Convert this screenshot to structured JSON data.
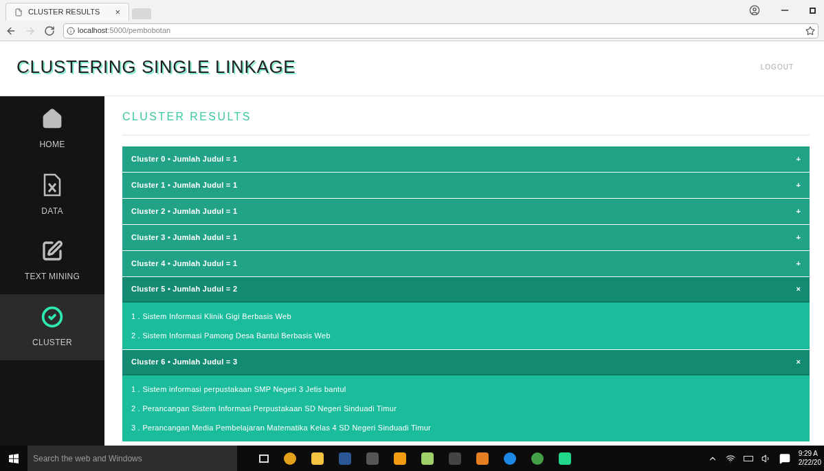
{
  "browser": {
    "tab_title": "CLUSTER RESULTS",
    "tab_close": "×",
    "url_host": "localhost",
    "url_path": ":5000/pembobotan"
  },
  "header": {
    "title": "CLUSTERING SINGLE LINKAGE",
    "logout": "LOGOUT"
  },
  "sidebar": {
    "items": [
      {
        "label": "HOME",
        "kind": "home",
        "selected": false
      },
      {
        "label": "DATA",
        "kind": "data",
        "selected": false
      },
      {
        "label": "TEXT MINING",
        "kind": "edit",
        "selected": false
      },
      {
        "label": "CLUSTER",
        "kind": "check",
        "selected": true
      }
    ]
  },
  "page_title": "CLUSTER RESULTS",
  "clusters": [
    {
      "title": "Cluster 0 • Jumlah Judul = 1",
      "toggle": "+",
      "expanded": false
    },
    {
      "title": "Cluster 1 • Jumlah Judul = 1",
      "toggle": "+",
      "expanded": false
    },
    {
      "title": "Cluster 2 • Jumlah Judul = 1",
      "toggle": "+",
      "expanded": false
    },
    {
      "title": "Cluster 3 • Jumlah Judul = 1",
      "toggle": "+",
      "expanded": false
    },
    {
      "title": "Cluster 4 • Jumlah Judul = 1",
      "toggle": "+",
      "expanded": false
    },
    {
      "title": "Cluster 5 • Jumlah Judul = 2",
      "toggle": "×",
      "expanded": true,
      "items": [
        "1 . Sistem Informasi Klinik Gigi Berbasis Web",
        "2 . Sistem Informasi Pamong Desa Bantul Berbasis Web"
      ]
    },
    {
      "title": "Cluster 6 • Jumlah Judul = 3",
      "toggle": "×",
      "expanded": true,
      "items": [
        "1 . Sistem informasi perpustakaan SMP Negeri 3 Jetis bantul",
        "2 . Perancangan Sistem Informasi Perpustakaan SD Negeri Sinduadi Timur",
        "3 . Perancangan Media Pembelajaran Matematika Kelas 4 SD Negeri Sinduadi Timur"
      ]
    }
  ],
  "taskbar": {
    "search_placeholder": "Search the web and Windows",
    "time": "9:29 A",
    "date": "2/22/20"
  }
}
